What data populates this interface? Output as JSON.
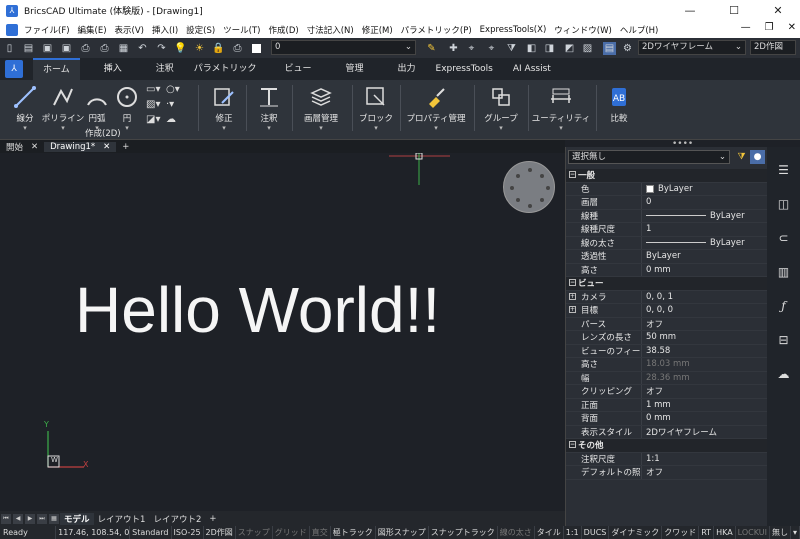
{
  "window": {
    "title": "BricsCAD Ultimate (体験版) - [Drawing1]"
  },
  "menu": [
    "ファイル(F)",
    "編集(E)",
    "表示(V)",
    "挿入(I)",
    "設定(S)",
    "ツール(T)",
    "作成(D)",
    "寸法記入(N)",
    "修正(M)",
    "パラメトリック(P)",
    "ExpressTools(X)",
    "ウィンドウ(W)",
    "ヘルプ(H)"
  ],
  "toolbar": {
    "layer": "0",
    "visual_style": "2Dワイヤフレーム",
    "workspace": "2D作図"
  },
  "ribbon_tabs": [
    "ホーム",
    "挿入",
    "注釈",
    "パラメトリック",
    "ビュー",
    "管理",
    "出力",
    "ExpressTools",
    "AI Assist"
  ],
  "ribbon": {
    "draw": [
      "線分",
      "ポリライン",
      "円弧",
      "円"
    ],
    "draw_group": "作成(2D)",
    "groups": [
      "修正",
      "注釈",
      "画層管理",
      "ブロック",
      "プロパティ管理",
      "グループ",
      "ユーティリティ",
      "比較"
    ]
  },
  "doc_tabs": {
    "start": "開始",
    "drawing": "Drawing1*",
    "add": "+"
  },
  "canvas": {
    "text": "Hello World!!",
    "ucs_y": "Y",
    "ucs_x": "X",
    "ucs_w": "W"
  },
  "layout_tabs": [
    "モデル",
    "レイアウト1",
    "レイアウト2",
    "+"
  ],
  "status": {
    "ready": "Ready",
    "coords": "117.46, 108.54, 0",
    "items": [
      "Standard",
      "ISO-25",
      "2D作図",
      "スナップ",
      "グリッド",
      "直交",
      "極トラック",
      "図形スナップ",
      "スナップトラック",
      "線の太さ",
      "タイル",
      "1:1",
      "DUCS",
      "ダイナミック",
      "クワッド",
      "RT",
      "HKA",
      "LOCKUI",
      "無し"
    ]
  },
  "properties": {
    "selection": "選択無し",
    "general": {
      "title": "一般",
      "rows": [
        [
          "色",
          "ByLayer"
        ],
        [
          "画層",
          "0"
        ],
        [
          "線種",
          "ByLayer"
        ],
        [
          "線種尺度",
          "1"
        ],
        [
          "線の太さ",
          "ByLayer"
        ],
        [
          "透過性",
          "ByLayer"
        ],
        [
          "高さ",
          "0 mm"
        ]
      ]
    },
    "view": {
      "title": "ビュー",
      "rows": [
        [
          "カメラ",
          "0, 0, 1"
        ],
        [
          "目標",
          "0, 0, 0"
        ],
        [
          "パース",
          "オフ"
        ],
        [
          "レンズの長さ",
          "50 mm"
        ],
        [
          "ビューのフィールド",
          "38.58"
        ],
        [
          "高さ",
          "18.03 mm"
        ],
        [
          "幅",
          "28.36 mm"
        ],
        [
          "クリッピング",
          "オフ"
        ],
        [
          "正面",
          "1 mm"
        ],
        [
          "背面",
          "0 mm"
        ],
        [
          "表示スタイル",
          "2Dワイヤフレーム"
        ]
      ]
    },
    "other": {
      "title": "その他",
      "rows": [
        [
          "注釈尺度",
          "1:1"
        ],
        [
          "デフォルトの照明",
          "オフ"
        ]
      ]
    }
  }
}
